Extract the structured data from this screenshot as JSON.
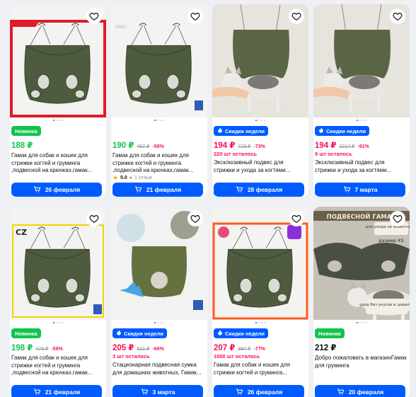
{
  "accent": "#005bff",
  "badge_green": "#10c44c",
  "sale_color": "#f91155",
  "products": [
    {
      "badge": "Новинка",
      "badge_type": "green",
      "price": "188 ₽",
      "price_color": "green",
      "old_price": "",
      "discount": "",
      "stock": "",
      "title": "Гамак для собак и кошек для стрижки когтей и груминга ,подвесной на крючках,гамак...",
      "rating": "",
      "reviews": "",
      "delivery": "26 февраля",
      "image": "hammock-red-frame"
    },
    {
      "badge": "",
      "badge_type": "",
      "price": "190 ₽",
      "price_color": "green",
      "old_price": "457 ₽",
      "discount": "-58%",
      "stock": "",
      "title": "Гамак для собак и кошек для стрижки когтей и груминга ,подвесной на крючках,гамак...",
      "rating": "5.0",
      "reviews": "1 отзыв",
      "delivery": "21 февраля",
      "image": "hammock-plain"
    },
    {
      "badge": "Скидки недели",
      "badge_type": "blue",
      "price": "194 ₽",
      "price_color": "pink",
      "old_price": "723 ₽",
      "discount": "-73%",
      "stock": "220 шт осталось",
      "title": "Эксклюзивный подвес для стрижки и ухода за когтями...",
      "rating": "",
      "reviews": "",
      "delivery": "28 февраля",
      "image": "hammock-cat"
    },
    {
      "badge": "Скидки недели",
      "badge_type": "blue",
      "price": "194 ₽",
      "price_color": "pink",
      "old_price": "2217 ₽",
      "discount": "-91%",
      "stock": "9 шт осталось",
      "title": "Эксклюзивный подвес для стрижки и ухода за когтями...",
      "rating": "",
      "reviews": "",
      "delivery": "7 марта",
      "image": "hammock-cat"
    },
    {
      "badge": "Новинка",
      "badge_type": "green",
      "price": "198 ₽",
      "price_color": "green",
      "old_price": "478 ₽",
      "discount": "-58%",
      "stock": "",
      "title": "Гамак для собак и кошек для стрижки когтей и груминга ,подвесной на крючках,гамак...",
      "rating": "",
      "reviews": "",
      "delivery": "21 февраля",
      "image": "hammock-yellow-frame"
    },
    {
      "badge": "Скидки недели",
      "badge_type": "blue",
      "price": "205 ₽",
      "price_color": "pink",
      "old_price": "621 ₽",
      "discount": "-66%",
      "stock": "3 шт осталось",
      "title": "Стационарная подвесная сумка для домашних животных, Гамак...",
      "rating": "",
      "reviews": "",
      "delivery": "3 марта",
      "image": "hammock-collage"
    },
    {
      "badge": "Скидки недели",
      "badge_type": "blue",
      "price": "207 ₽",
      "price_color": "pink",
      "old_price": "897 ₽",
      "discount": "-77%",
      "stock": "1000 шт осталось",
      "title": "Гамак для собак и кошек для стрижки когтей и груминга...",
      "rating": "",
      "reviews": "",
      "delivery": "26 февраля",
      "image": "hammock-orange-frame"
    },
    {
      "badge": "Новинка",
      "badge_type": "green",
      "price": "212 ₽",
      "price_color": "plain",
      "old_price": "",
      "discount": "",
      "stock": "",
      "title": "Добро пожаловать в магазинГамак для груминга",
      "rating": "",
      "reviews": "",
      "delivery": "20 февраля",
      "image": "hammock-banner",
      "image_text": [
        "ПОДВЕСНОЙ ГАМАК",
        "для ухода за животными",
        "размер XS",
        "уход без укусов и царапин"
      ]
    }
  ]
}
